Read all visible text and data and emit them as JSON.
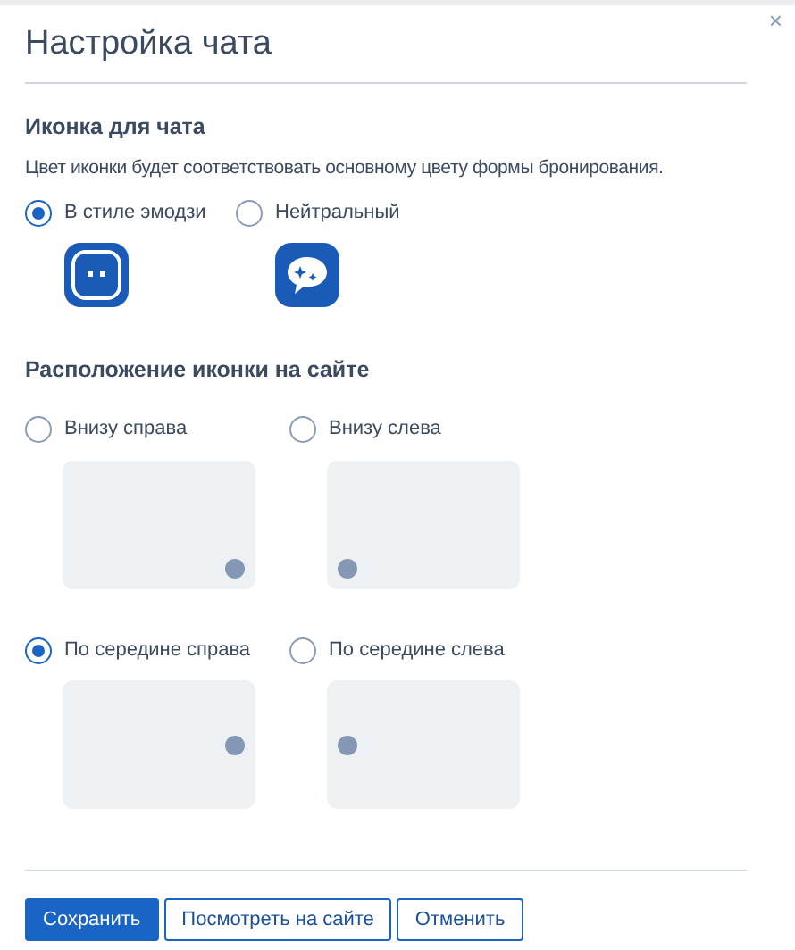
{
  "dialog": {
    "title": "Настройка чата",
    "close": "×"
  },
  "icon_section": {
    "heading": "Иконка для чата",
    "description": "Цвет иконки будет соответствовать основному цвету формы бронирования.",
    "options": [
      {
        "label": "В стиле эмодзи",
        "selected": true,
        "kind": "emoji"
      },
      {
        "label": "Нейтральный",
        "selected": false,
        "kind": "neutral"
      }
    ]
  },
  "position_section": {
    "heading": "Расположение иконки на сайте",
    "options": [
      {
        "label": "Внизу справа",
        "selected": false,
        "kind": "bottom_right"
      },
      {
        "label": "Внизу слева",
        "selected": false,
        "kind": "bottom_left"
      },
      {
        "label": "По середине справа",
        "selected": true,
        "kind": "middle_right"
      },
      {
        "label": "По середине слева",
        "selected": false,
        "kind": "middle_left"
      }
    ]
  },
  "buttons": [
    {
      "label": "Сохранить",
      "kind": "primary"
    },
    {
      "label": "Посмотреть на сайте",
      "kind": "secondary"
    },
    {
      "label": "Отменить",
      "kind": "secondary"
    }
  ]
}
